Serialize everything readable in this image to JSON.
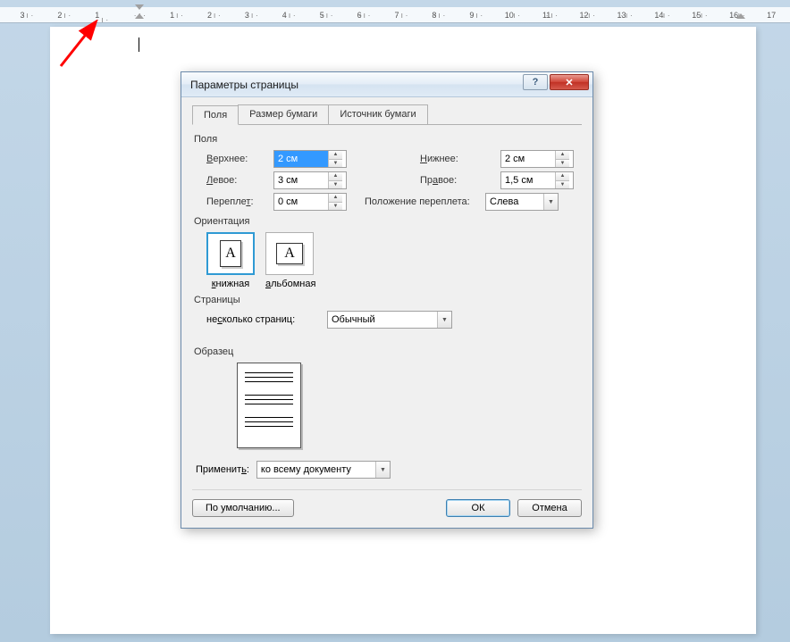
{
  "ruler": {
    "numbers": [
      "3",
      "2",
      "1",
      "",
      "1",
      "2",
      "3",
      "4",
      "5",
      "6",
      "7",
      "8",
      "9",
      "10",
      "11",
      "12",
      "13",
      "14",
      "15",
      "16",
      "17"
    ]
  },
  "arrow_color": "#ff0000",
  "dialog": {
    "title": "Параметры страницы",
    "help_label": "?",
    "close_label": "✕",
    "tabs": {
      "fields": "Поля",
      "paper_size": "Размер бумаги",
      "paper_source": "Источник бумаги"
    },
    "groups": {
      "margins": "Поля",
      "orientation": "Ориентация",
      "pages": "Страницы",
      "preview": "Образец"
    },
    "margins": {
      "top_label": "Верхнее:",
      "top_value": "2 см",
      "bottom_label": "Нижнее:",
      "bottom_value": "2 см",
      "left_label": "Левое:",
      "left_value": "3 см",
      "right_label": "Правое:",
      "right_value": "1,5 см",
      "gutter_label": "Переплет:",
      "gutter_value": "0 см",
      "gutter_pos_label": "Положение переплета:",
      "gutter_pos_value": "Слева"
    },
    "orientation": {
      "portrait": "книжная",
      "landscape": "альбомная",
      "glyph": "A"
    },
    "multi_pages_label": "несколько страниц:",
    "multi_pages_value": "Обычный",
    "apply_label": "Применить:",
    "apply_value": "ко всему документу",
    "defaults_button": "По умолчанию...",
    "ok_button": "ОК",
    "cancel_button": "Отмена"
  }
}
